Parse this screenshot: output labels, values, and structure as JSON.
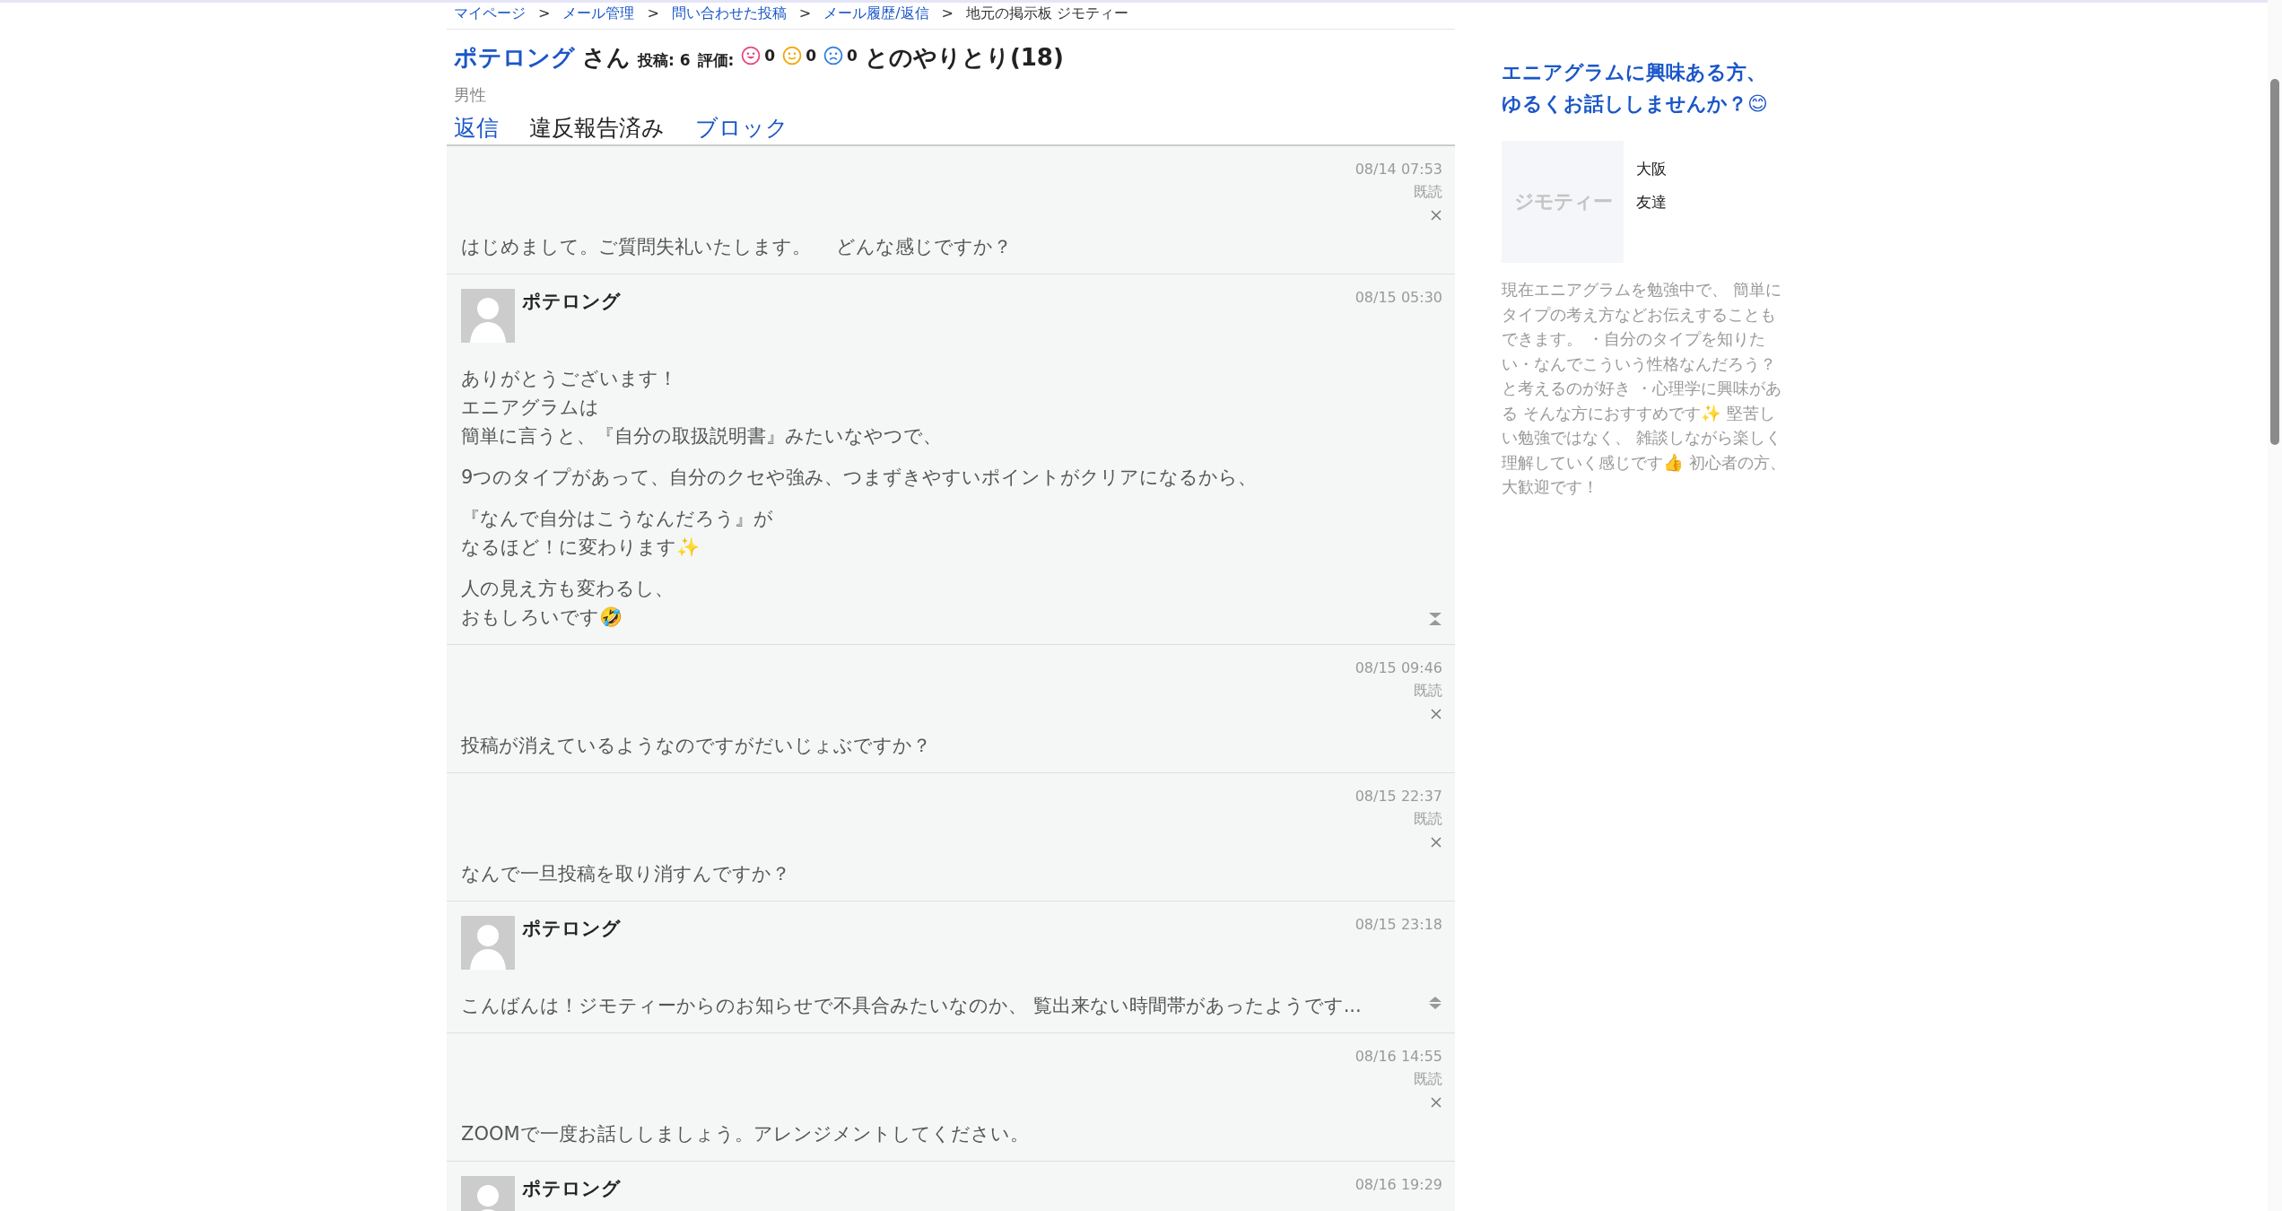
{
  "breadcrumb_separator": ">",
  "breadcrumb": [
    {
      "label": "マイページ",
      "link": true
    },
    {
      "label": "メール管理",
      "link": true
    },
    {
      "label": "問い合わせた投稿",
      "link": true
    },
    {
      "label": "メール履歴/返信",
      "link": true
    },
    {
      "label": "地元の掲示板 ジモティー",
      "link": false
    }
  ],
  "header": {
    "name": "ポテロング",
    "honorific": "さん",
    "posts_label": "投稿:",
    "posts": "6",
    "rating_label": "評価:",
    "ratings": [
      {
        "kind": "good",
        "color": "#e8457a",
        "count": "0"
      },
      {
        "kind": "neutral",
        "color": "#f0a500",
        "count": "0"
      },
      {
        "kind": "bad",
        "color": "#2f7fd8",
        "count": "0"
      }
    ],
    "suffix": "とのやりとり(18)",
    "gender": "男性"
  },
  "actions": [
    {
      "label": "返信",
      "link": true
    },
    {
      "label": "違反報告済み",
      "link": false
    },
    {
      "label": "ブロック",
      "link": true
    }
  ],
  "messages": [
    {
      "kind": "sent",
      "time": "08/14 07:53",
      "status": "既読",
      "paragraphs": [
        [
          "はじめまして。ご質問失礼いたします。　 どんな感じですか？"
        ]
      ]
    },
    {
      "kind": "received",
      "name": "ポテロング",
      "time": "08/15 05:30",
      "expanded": true,
      "paragraphs": [
        [
          "ありがとうございます！",
          "エニアグラムは",
          "簡単に言うと、『自分の取扱説明書』みたいなやつで、"
        ],
        [
          "9つのタイプがあって、自分のクセや強み、つまずきやすいポイントがクリアになるから、"
        ],
        [
          "『なんで自分はこうなんだろう』が",
          "なるほど！に変わります✨"
        ],
        [
          "人の見え方も変わるし、",
          "おもしろいです🤣"
        ]
      ]
    },
    {
      "kind": "sent",
      "time": "08/15 09:46",
      "status": "既読",
      "paragraphs": [
        [
          "投稿が消えているようなのですがだいじょぶですか？"
        ]
      ]
    },
    {
      "kind": "sent",
      "time": "08/15 22:37",
      "status": "既読",
      "paragraphs": [
        [
          "なんで一旦投稿を取り消すんですか？"
        ]
      ]
    },
    {
      "kind": "received",
      "name": "ポテロング",
      "time": "08/15 23:18",
      "expanded": false,
      "paragraphs": [
        [
          "こんばんは！ジモティーからのお知らせで不具合みたいなのか、 覧出来ない時間帯があったようです..."
        ]
      ]
    },
    {
      "kind": "sent",
      "time": "08/16 14:55",
      "status": "既読",
      "paragraphs": [
        [
          "ZOOMで一度お話ししましょう。アレンジメントしてください。"
        ]
      ]
    },
    {
      "kind": "received",
      "name": "ポテロング",
      "time": "08/16 19:29"
    }
  ],
  "sidebar": {
    "title": [
      "エニアグラムに興味ある方、",
      "ゆるくお話ししませんか？😊"
    ],
    "image_logo": "ジモティー",
    "details": [
      "大阪",
      "友達"
    ],
    "description": "現在エニアグラムを勉強中で、 簡単にタイプの考え方などお伝えすることもできます。 ・自分のタイプを知りたい・なんでこういう性格なんだろう？と考えるのが好き ・心理学に興味がある そんな方におすすめです✨ 堅苦しい勉強ではなく、 雑談しながら楽しく理解していく感じです👍 初心者の方、大歓迎です！"
  }
}
